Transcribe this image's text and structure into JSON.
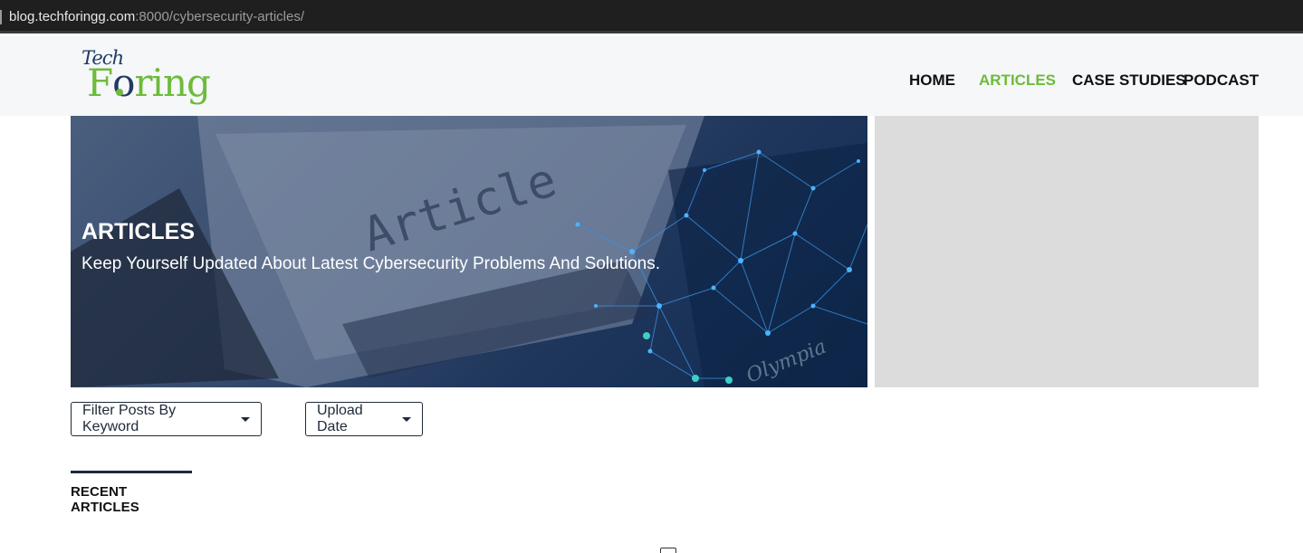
{
  "browser": {
    "url_host": "blog.techforingg.com",
    "url_rest": ":8000/cybersecurity-articles/"
  },
  "logo": {
    "line1": "Tech",
    "line2_a": "F",
    "line2_o": "o",
    "line2_b": "ring"
  },
  "nav": {
    "items": [
      {
        "label": "HOME"
      },
      {
        "label": "ARTICLES",
        "active": true
      },
      {
        "label": "CASE STUDIES"
      },
      {
        "label": "PODCAST"
      }
    ]
  },
  "hero": {
    "title": "ARTICLES",
    "subtitle": "Keep Yourself Updated About Latest Cybersecurity Problems And Solutions."
  },
  "filters": {
    "keyword_label": "Filter Posts By Keyword",
    "date_label": "Upload Date"
  },
  "section": {
    "title": "RECENT ARTICLES"
  },
  "colors": {
    "accent": "#6dbb3b",
    "brand_dark": "#1f3a63"
  }
}
